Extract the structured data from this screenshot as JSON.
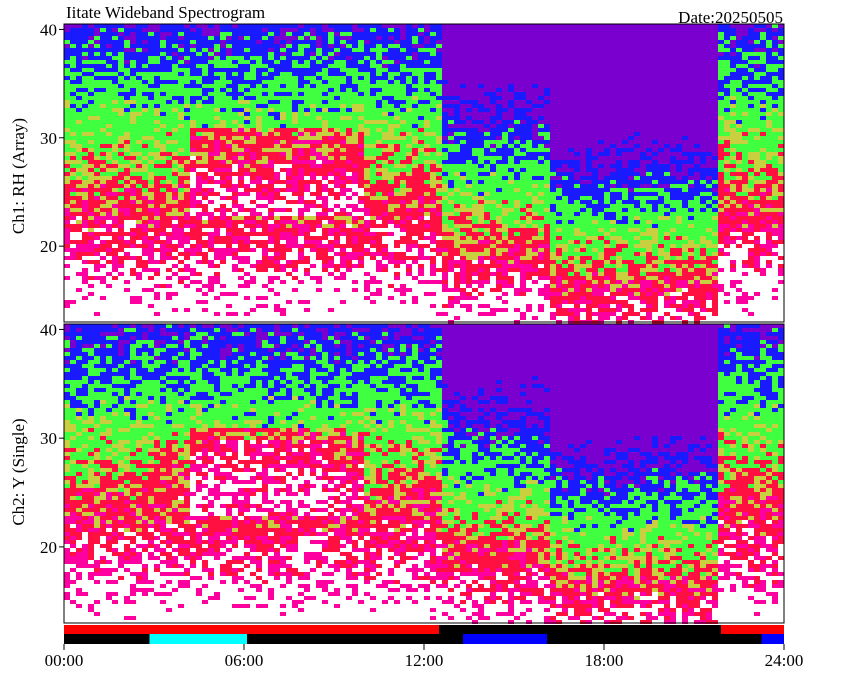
{
  "title": "Iitate Wideband Spectrogram",
  "date_label": "Date:20250505",
  "chart_data": [
    {
      "type": "heatmap",
      "ylabel": "Ch1: RH (Array)",
      "xlim": [
        "00:00",
        "24:00"
      ],
      "ylim": [
        13,
        40.5
      ],
      "yticks": [
        20,
        30,
        40
      ],
      "grid": false
    },
    {
      "type": "heatmap",
      "ylabel": "Ch2: Y (Single)",
      "xlim": [
        "00:00",
        "24:00"
      ],
      "ylim": [
        13,
        40.5
      ],
      "yticks": [
        20,
        30,
        40
      ],
      "xticks": [
        "00:00",
        "06:00",
        "12:00",
        "18:00",
        "24:00"
      ],
      "grid": false
    }
  ],
  "status_bars": [
    {
      "row": "upper",
      "segments": [
        {
          "start": 0,
          "end": 12.5,
          "color": "#ff0000"
        },
        {
          "start": 12.5,
          "end": 21.9,
          "color": "#000000"
        },
        {
          "start": 21.9,
          "end": 24,
          "color": "#ff0000"
        }
      ]
    },
    {
      "row": "lower",
      "segments": [
        {
          "start": 0,
          "end": 2.85,
          "color": "#000000"
        },
        {
          "start": 2.85,
          "end": 6.1,
          "color": "#00ffff"
        },
        {
          "start": 6.1,
          "end": 13.3,
          "color": "#000000"
        },
        {
          "start": 13.3,
          "end": 16.1,
          "color": "#0000ff"
        },
        {
          "start": 16.1,
          "end": 23.25,
          "color": "#000000"
        },
        {
          "start": 23.25,
          "end": 24,
          "color": "#0000ff"
        }
      ]
    }
  ],
  "colors": {
    "purple": "#7a00d0",
    "blue": "#1a1aff",
    "green": "#40ff40",
    "yellow_green": "#c8d040",
    "red": "#ff1040",
    "magenta": "#ff00a0",
    "white": "#ffffff"
  }
}
